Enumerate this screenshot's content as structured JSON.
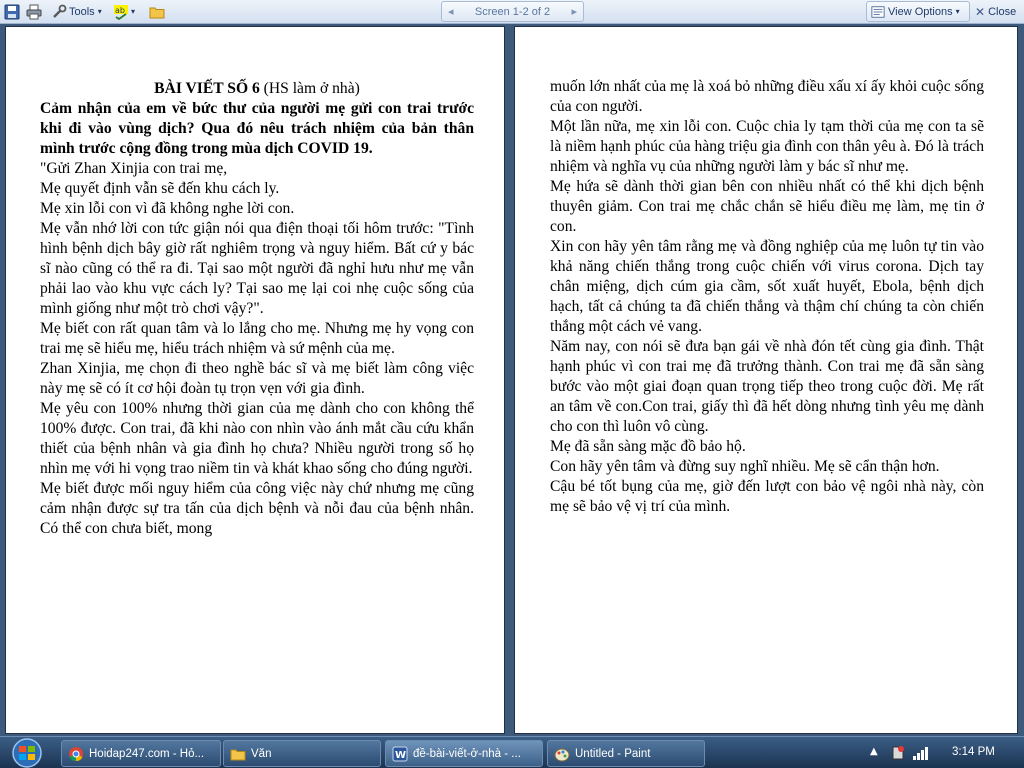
{
  "toolbar": {
    "tools_label": "Tools",
    "screen_label": "Screen 1-2 of 2",
    "view_options_label": "View Options",
    "close_label": "Close"
  },
  "document": {
    "left_page": {
      "title_bold": "BÀI VIẾT SỐ 6",
      "title_rest": " (HS làm ở nhà)",
      "prompt": "Cảm nhận của em về bức thư của người mẹ gửi con trai trước khi đi vào vùng dịch? Qua đó nêu trách nhiệm của bản thân mình trước cộng đồng trong mùa dịch COVID 19.",
      "paragraphs": [
        "\"Gửi Zhan Xinjia con trai mẹ,",
        "Mẹ quyết định vẫn sẽ đến khu cách ly.",
        "Mẹ xin lỗi con vì đã không nghe lời con.",
        "Mẹ vẫn nhớ lời con tức giận nói qua điện thoại tối hôm trước: \"Tình hình bệnh dịch bây giờ rất nghiêm trọng và nguy hiểm. Bất cứ y bác sĩ nào cũng có thể ra đi. Tại sao một người đã nghỉ hưu như mẹ vẫn phải lao vào khu vực cách ly? Tại sao mẹ lại coi nhẹ cuộc sống của mình giống như một trò chơi vậy?\".",
        "Mẹ biết con rất quan tâm và lo lắng cho mẹ. Nhưng mẹ hy vọng con trai mẹ sẽ hiểu mẹ, hiểu trách nhiệm và sứ mệnh của mẹ.",
        "Zhan Xinjia, mẹ chọn đi theo nghề bác sĩ và mẹ biết làm công việc này mẹ sẽ có ít cơ hội đoàn tụ trọn vẹn với gia đình.",
        "Mẹ yêu con 100% nhưng thời gian của mẹ dành cho con không thể 100% được. Con trai, đã khi nào con nhìn vào ánh mắt cầu cứu khẩn thiết của bệnh nhân và gia đình họ chưa? Nhiều người trong số họ nhìn mẹ với hi vọng trao niềm tin và khát khao sống cho đúng người.",
        "Mẹ biết được mối nguy hiểm của công việc này chứ nhưng mẹ cũng cảm nhận được sự tra tấn của dịch bệnh và nỗi đau của bệnh nhân. Có thể con chưa biết, mong"
      ]
    },
    "right_page": {
      "paragraphs": [
        "muốn lớn nhất của mẹ là xoá bỏ những điều xấu xí ấy khỏi cuộc sống của con người.",
        "Một lần nữa, mẹ xin lỗi con. Cuộc chia ly tạm thời của mẹ con ta sẽ là niềm hạnh phúc của hàng triệu gia đình con thân yêu à. Đó là trách nhiệm và nghĩa vụ của những người làm y bác sĩ như mẹ.",
        "Mẹ hứa sẽ dành thời gian bên con nhiều nhất có thể khi dịch bệnh thuyên giảm. Con trai mẹ chắc chắn sẽ hiểu điều mẹ làm, mẹ tin ở con.",
        "Xin con hãy yên tâm rằng mẹ và đồng nghiệp của mẹ luôn tự tin vào khả năng chiến thắng trong cuộc chiến với virus corona. Dịch tay chân miệng, dịch cúm gia cầm, sốt xuất huyết, Ebola, bệnh dịch hạch, tất cả chúng ta đã chiến thắng và thậm chí chúng ta còn chiến thắng một cách vẻ vang.",
        "Năm nay, con nói sẽ đưa bạn gái về nhà đón tết cùng gia đình. Thật hạnh phúc vì con trai mẹ đã trưởng thành. Con trai mẹ đã sẵn sàng bước vào một giai đoạn quan trọng tiếp theo trong cuộc đời. Mẹ rất an tâm về con.Con trai, giấy thì đã hết dòng nhưng tình yêu mẹ dành cho con thì luôn vô cùng.",
        "Mẹ đã sẵn sàng mặc đồ bảo hộ.",
        "Con hãy yên tâm và đừng suy nghĩ nhiều. Mẹ sẽ cẩn thận hơn.",
        "Cậu bé tốt bụng của mẹ, giờ đến lượt con bảo vệ ngôi nhà này, còn mẹ sẽ bảo vệ vị trí của mình."
      ]
    }
  },
  "taskbar": {
    "tasks": [
      {
        "label": "Hoidap247.com - Hỏ...",
        "icon": "chrome-icon"
      },
      {
        "label": "Văn",
        "icon": "folder-icon"
      },
      {
        "label": "đề-bài-viết-ở-nhà - ...",
        "icon": "word-icon"
      },
      {
        "label": "Untitled - Paint",
        "icon": "paint-icon"
      }
    ],
    "clock": "3:14 PM"
  }
}
